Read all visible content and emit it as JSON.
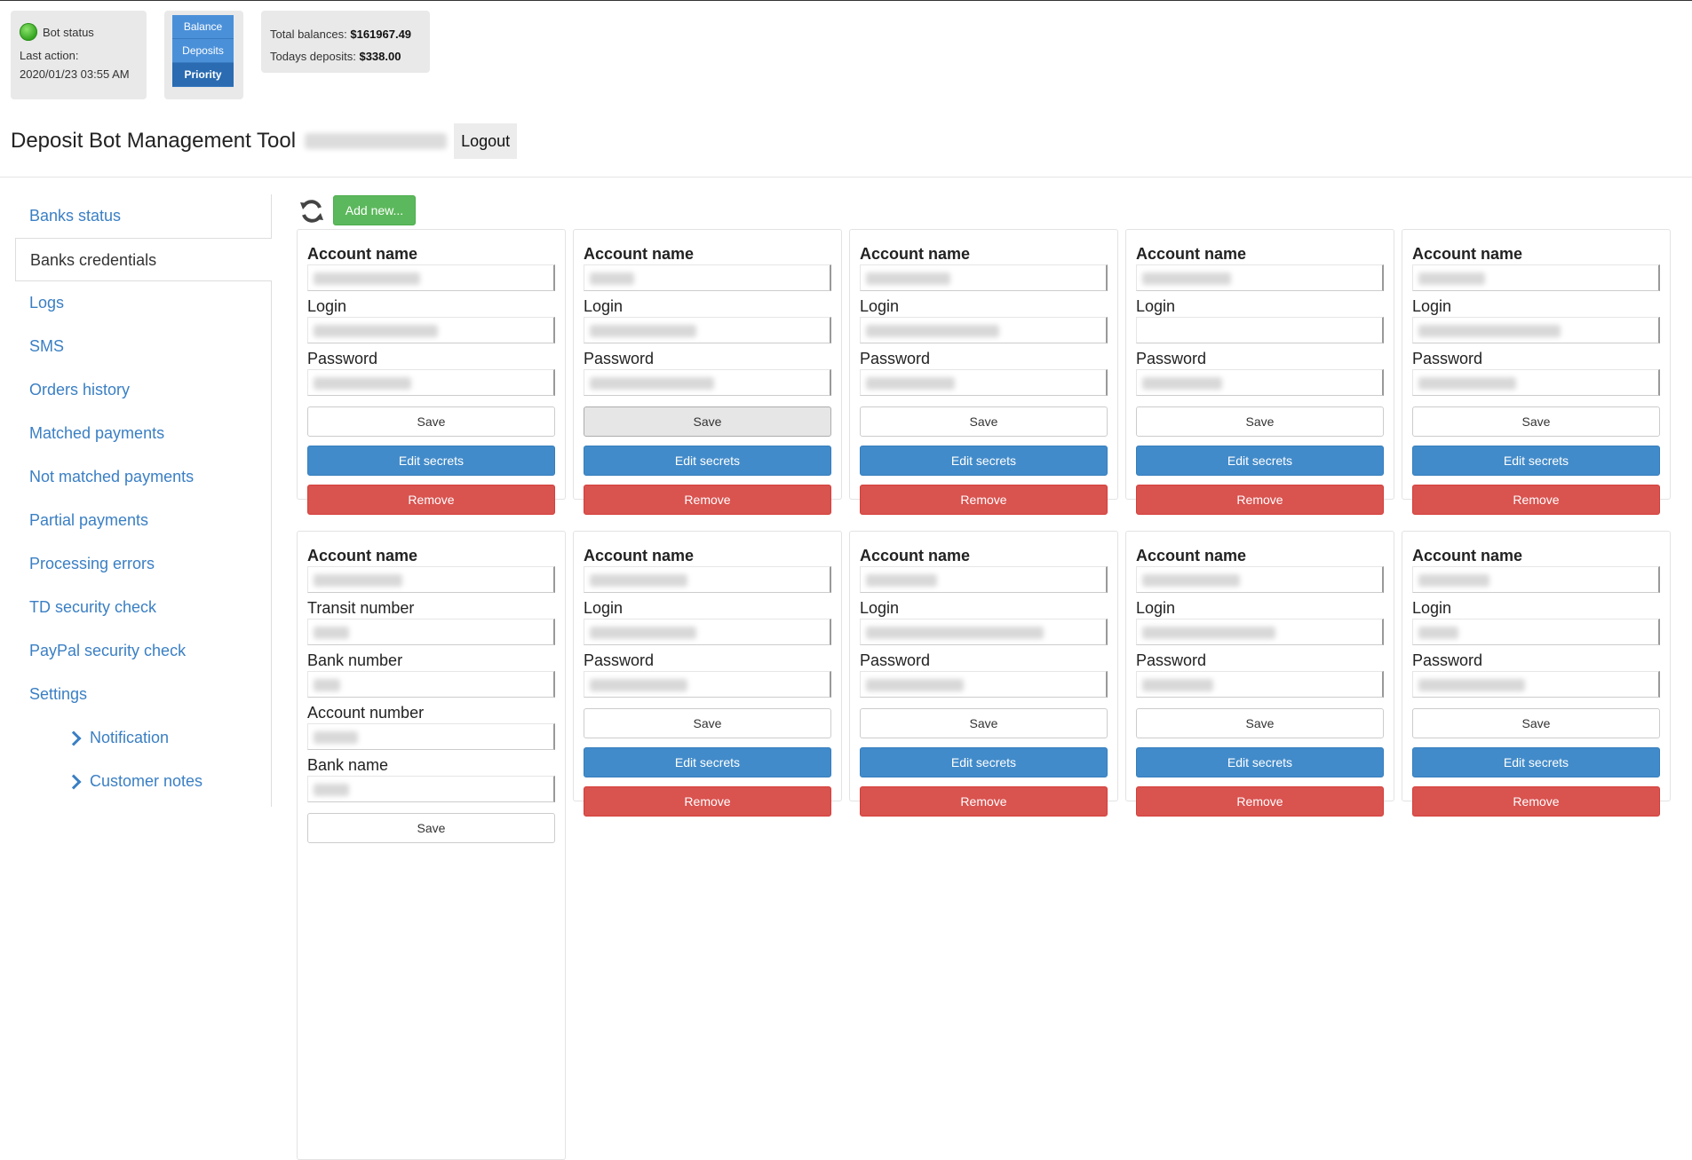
{
  "status": {
    "bot_status_label": "Bot status",
    "last_action_label": "Last action:",
    "last_action_time": "2020/01/23 03:55 AM",
    "indicator_color": "#3cb521"
  },
  "modes": [
    "Balance",
    "Deposits",
    "Priority"
  ],
  "totals": {
    "total_balances_label": "Total balances:",
    "total_balances_value": "$161967.49",
    "todays_deposits_label": "Todays deposits:",
    "todays_deposits_value": "$338.00"
  },
  "header": {
    "title": "Deposit Bot Management Tool",
    "logout_label": "Logout"
  },
  "sidebar": {
    "items": [
      {
        "label": "Banks status"
      },
      {
        "label": "Banks credentials"
      },
      {
        "label": "Logs"
      },
      {
        "label": "SMS"
      },
      {
        "label": "Orders history"
      },
      {
        "label": "Matched payments"
      },
      {
        "label": "Not matched payments"
      },
      {
        "label": "Partial payments"
      },
      {
        "label": "Processing errors"
      },
      {
        "label": "TD security check"
      },
      {
        "label": "PayPal security check"
      },
      {
        "label": "Settings"
      }
    ],
    "sub_items": [
      {
        "label": "Notification"
      },
      {
        "label": "Customer notes"
      }
    ]
  },
  "toolbar": {
    "add_label": "Add new...",
    "refresh_icon": "refresh-icon"
  },
  "buttons": {
    "save": "Save",
    "edit": "Edit secrets",
    "remove": "Remove"
  },
  "cards": [
    {
      "fields": [
        "Account name",
        "Login",
        "Password"
      ]
    },
    {
      "fields": [
        "Account name",
        "Login",
        "Password"
      ]
    },
    {
      "fields": [
        "Account name",
        "Login",
        "Password"
      ]
    },
    {
      "fields": [
        "Account name",
        "Login",
        "Password"
      ]
    },
    {
      "fields": [
        "Account name",
        "Login",
        "Password"
      ]
    },
    {
      "fields": [
        "Account name",
        "Transit number",
        "Bank number",
        "Account number",
        "Bank name"
      ]
    },
    {
      "fields": [
        "Account name",
        "Login",
        "Password"
      ]
    },
    {
      "fields": [
        "Account name",
        "Login",
        "Password"
      ]
    },
    {
      "fields": [
        "Account name",
        "Login",
        "Password"
      ]
    },
    {
      "fields": [
        "Account name",
        "Login",
        "Password"
      ]
    }
  ],
  "colors": {
    "link": "#3a7fc4",
    "add_button": "#5cb85c",
    "edit_button": "#428bca",
    "remove_button": "#d9534f"
  }
}
